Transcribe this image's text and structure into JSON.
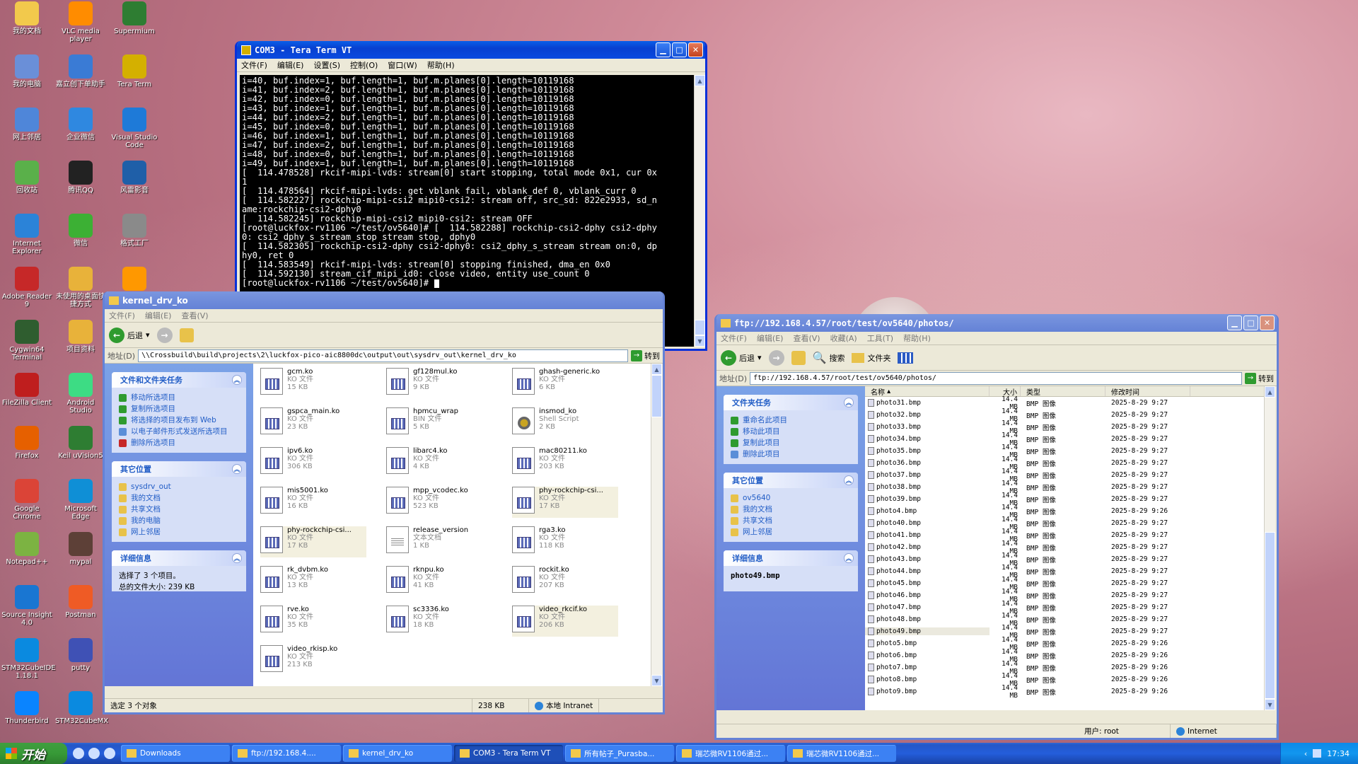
{
  "desktop_icons": [
    {
      "label": "我的文档",
      "color": "#f2c94c"
    },
    {
      "label": "VLC media player",
      "color": "#ff8c00"
    },
    {
      "label": "Supermium",
      "color": "#2e7d32"
    },
    {
      "label": "我的电脑",
      "color": "#6a8fd8"
    },
    {
      "label": "嘉立创下单助手",
      "color": "#3a7bd5"
    },
    {
      "label": "Tera Term",
      "color": "#d4b000"
    },
    {
      "label": "网上邻居",
      "color": "#4f86d9"
    },
    {
      "label": "企业微信",
      "color": "#2f88e0"
    },
    {
      "label": "Visual Studio Code",
      "color": "#1e7ad8"
    },
    {
      "label": "回收站",
      "color": "#5ab04a"
    },
    {
      "label": "腾讯QQ",
      "color": "#222222"
    },
    {
      "label": "风雷影音",
      "color": "#1f5fa8"
    },
    {
      "label": "Internet Explorer",
      "color": "#2b83d8"
    },
    {
      "label": "微信",
      "color": "#3cb034"
    },
    {
      "label": "格式工厂",
      "color": "#8a8a8a"
    },
    {
      "label": "Adobe Reader 9",
      "color": "#c62828"
    },
    {
      "label": "未使用的桌面快捷方式",
      "color": "#e8b23a"
    },
    {
      "label": "",
      "color": "#ff9800"
    },
    {
      "label": "Cygwin64 Terminal",
      "color": "#2f5d2f"
    },
    {
      "label": "项目资料",
      "color": "#e8b23a"
    },
    {
      "label": "FileZilla Client",
      "color": "#bf1e1e"
    },
    {
      "label": "Android Studio",
      "color": "#3ddc84"
    },
    {
      "label": "Firefox",
      "color": "#e66000"
    },
    {
      "label": "Keil uVision5",
      "color": "#2e7d32"
    },
    {
      "label": "Google Chrome",
      "color": "#db4437"
    },
    {
      "label": "Microsoft Edge",
      "color": "#0f8fd6"
    },
    {
      "label": "Notepad++",
      "color": "#7cb342"
    },
    {
      "label": "mypal",
      "color": "#5d4037"
    },
    {
      "label": "Source Insight 4.0",
      "color": "#1976d2"
    },
    {
      "label": "Postman",
      "color": "#ef5b25"
    },
    {
      "label": "STM32CubeIDE 1.18.1",
      "color": "#0a8ae0"
    },
    {
      "label": "putty",
      "color": "#3f51b5"
    },
    {
      "label": "Thunderbird",
      "color": "#0a84ff"
    },
    {
      "label": "STM32CubeMX",
      "color": "#0a8ae0"
    }
  ],
  "tera": {
    "title": "COM3 - Tera Term VT",
    "menu": [
      "文件(F)",
      "编辑(E)",
      "设置(S)",
      "控制(O)",
      "窗口(W)",
      "帮助(H)"
    ],
    "lines": [
      "i=40, buf.index=1, buf.length=1, buf.m.planes[0].length=10119168",
      "i=41, buf.index=2, buf.length=1, buf.m.planes[0].length=10119168",
      "i=42, buf.index=0, buf.length=1, buf.m.planes[0].length=10119168",
      "i=43, buf.index=1, buf.length=1, buf.m.planes[0].length=10119168",
      "i=44, buf.index=2, buf.length=1, buf.m.planes[0].length=10119168",
      "i=45, buf.index=0, buf.length=1, buf.m.planes[0].length=10119168",
      "i=46, buf.index=1, buf.length=1, buf.m.planes[0].length=10119168",
      "i=47, buf.index=2, buf.length=1, buf.m.planes[0].length=10119168",
      "i=48, buf.index=0, buf.length=1, buf.m.planes[0].length=10119168",
      "i=49, buf.index=1, buf.length=1, buf.m.planes[0].length=10119168",
      "[  114.478528] rkcif-mipi-lvds: stream[0] start stopping, total mode 0x1, cur 0x",
      "1",
      "[  114.478564] rkcif-mipi-lvds: get vblank fail, vblank_def 0, vblank_curr 0",
      "[  114.582227] rockchip-mipi-csi2 mipi0-csi2: stream off, src_sd: 822e2933, sd_n",
      "ame:rockchip-csi2-dphy0",
      "[  114.582245] rockchip-mipi-csi2 mipi0-csi2: stream OFF",
      "[root@luckfox-rv1106 ~/test/ov5640]# [  114.582288] rockchip-csi2-dphy csi2-dphy",
      "0: csi2_dphy_s_stream_stop stream stop, dphy0",
      "[  114.582305] rockchip-csi2-dphy csi2-dphy0: csi2_dphy_s_stream stream on:0, dp",
      "hy0, ret 0",
      "[  114.583549] rkcif-mipi-lvds: stream[0] stopping finished, dma_en 0x0",
      "[  114.592130] stream_cif_mipi_id0: close video, entity use_count 0",
      "",
      "[root@luckfox-rv1106 ~/test/ov5640]# "
    ]
  },
  "kernel": {
    "title": "kernel_drv_ko",
    "menu": [
      "文件(F)",
      "编辑(E)",
      "查看(V)"
    ],
    "back": "后退",
    "addr_label": "地址(D)",
    "addr": "\\\\Crossbuild\\build\\projects\\2\\luckfox-pico-aic8800dc\\output\\out\\sysdrv_out\\kernel_drv_ko",
    "go": "转到",
    "tasks_title": "文件和文件夹任务",
    "tasks": [
      "移动所选项目",
      "复制所选项目",
      "将选择的项目发布到 Web",
      "以电子邮件形式发送所选项目",
      "删除所选项目"
    ],
    "places_title": "其它位置",
    "places": [
      "sysdrv_out",
      "我的文档",
      "共享文档",
      "我的电脑",
      "网上邻居"
    ],
    "details_title": "详细信息",
    "details_text": "选择了 3 个项目。",
    "details_text2": "总的文件大小: 239 KB",
    "files": [
      {
        "name": "gcm.ko",
        "type": "KO 文件",
        "size": "15 KB",
        "icon": "ko"
      },
      {
        "name": "gf128mul.ko",
        "type": "KO 文件",
        "size": "9 KB",
        "icon": "ko"
      },
      {
        "name": "ghash-generic.ko",
        "type": "KO 文件",
        "size": "6 KB",
        "icon": "ko"
      },
      {
        "name": "gspca_main.ko",
        "type": "KO 文件",
        "size": "23 KB",
        "icon": "ko"
      },
      {
        "name": "hpmcu_wrap",
        "type": "BIN 文件",
        "size": "5 KB",
        "icon": "ko"
      },
      {
        "name": "insmod_ko",
        "type": "Shell Script",
        "size": "2 KB",
        "icon": "gear"
      },
      {
        "name": "ipv6.ko",
        "type": "KO 文件",
        "size": "306 KB",
        "icon": "ko"
      },
      {
        "name": "libarc4.ko",
        "type": "KO 文件",
        "size": "4 KB",
        "icon": "ko"
      },
      {
        "name": "mac80211.ko",
        "type": "KO 文件",
        "size": "203 KB",
        "icon": "ko"
      },
      {
        "name": "mis5001.ko",
        "type": "KO 文件",
        "size": "16 KB",
        "icon": "ko"
      },
      {
        "name": "mpp_vcodec.ko",
        "type": "KO 文件",
        "size": "523 KB",
        "icon": "ko"
      },
      {
        "name": "phy-rockchip-csi...",
        "type": "KO 文件",
        "size": "17 KB",
        "icon": "ko",
        "sel": true
      },
      {
        "name": "phy-rockchip-csi...",
        "type": "KO 文件",
        "size": "17 KB",
        "icon": "ko",
        "sel": true
      },
      {
        "name": "release_version",
        "type": "文本文档",
        "size": "1 KB",
        "icon": "txt"
      },
      {
        "name": "rga3.ko",
        "type": "KO 文件",
        "size": "118 KB",
        "icon": "ko"
      },
      {
        "name": "rk_dvbm.ko",
        "type": "KO 文件",
        "size": "13 KB",
        "icon": "ko"
      },
      {
        "name": "rknpu.ko",
        "type": "KO 文件",
        "size": "41 KB",
        "icon": "ko"
      },
      {
        "name": "rockit.ko",
        "type": "KO 文件",
        "size": "207 KB",
        "icon": "ko"
      },
      {
        "name": "rve.ko",
        "type": "KO 文件",
        "size": "35 KB",
        "icon": "ko"
      },
      {
        "name": "sc3336.ko",
        "type": "KO 文件",
        "size": "18 KB",
        "icon": "ko"
      },
      {
        "name": "video_rkcif.ko",
        "type": "KO 文件",
        "size": "206 KB",
        "icon": "ko",
        "sel": true
      },
      {
        "name": "video_rkisp.ko",
        "type": "KO 文件",
        "size": "213 KB",
        "icon": "ko"
      }
    ],
    "status": [
      "选定 3 个对象",
      "238 KB",
      "本地 Intranet"
    ]
  },
  "ftp": {
    "title": "ftp://192.168.4.57/root/test/ov5640/photos/",
    "menu": [
      "文件(F)",
      "编辑(E)",
      "查看(V)",
      "收藏(A)",
      "工具(T)",
      "帮助(H)"
    ],
    "back": "后退",
    "search": "搜索",
    "folders": "文件夹",
    "addr_label": "地址(D)",
    "addr": "ftp://192.168.4.57/root/test/ov5640/photos/",
    "go": "转到",
    "tasks_title": "文件夹任务",
    "tasks": [
      "重命名此项目",
      "移动此项目",
      "复制此项目",
      "删除此项目"
    ],
    "places_title": "其它位置",
    "places": [
      "ov5640",
      "我的文档",
      "共享文档",
      "网上邻居"
    ],
    "details_title": "详细信息",
    "details_name": "photo49.bmp",
    "cols": [
      "名称",
      "大小",
      "类型",
      "修改时间"
    ],
    "rows": [
      [
        "photo31.bmp",
        "14.4 MB",
        "BMP 图像",
        "2025-8-29 9:27"
      ],
      [
        "photo32.bmp",
        "14.4 MB",
        "BMP 图像",
        "2025-8-29 9:27"
      ],
      [
        "photo33.bmp",
        "14.4 MB",
        "BMP 图像",
        "2025-8-29 9:27"
      ],
      [
        "photo34.bmp",
        "14.4 MB",
        "BMP 图像",
        "2025-8-29 9:27"
      ],
      [
        "photo35.bmp",
        "14.4 MB",
        "BMP 图像",
        "2025-8-29 9:27"
      ],
      [
        "photo36.bmp",
        "14.4 MB",
        "BMP 图像",
        "2025-8-29 9:27"
      ],
      [
        "photo37.bmp",
        "14.4 MB",
        "BMP 图像",
        "2025-8-29 9:27"
      ],
      [
        "photo38.bmp",
        "14.4 MB",
        "BMP 图像",
        "2025-8-29 9:27"
      ],
      [
        "photo39.bmp",
        "14.4 MB",
        "BMP 图像",
        "2025-8-29 9:27"
      ],
      [
        "photo4.bmp",
        "14.4 MB",
        "BMP 图像",
        "2025-8-29 9:26"
      ],
      [
        "photo40.bmp",
        "14.4 MB",
        "BMP 图像",
        "2025-8-29 9:27"
      ],
      [
        "photo41.bmp",
        "14.4 MB",
        "BMP 图像",
        "2025-8-29 9:27"
      ],
      [
        "photo42.bmp",
        "14.4 MB",
        "BMP 图像",
        "2025-8-29 9:27"
      ],
      [
        "photo43.bmp",
        "14.4 MB",
        "BMP 图像",
        "2025-8-29 9:27"
      ],
      [
        "photo44.bmp",
        "14.4 MB",
        "BMP 图像",
        "2025-8-29 9:27"
      ],
      [
        "photo45.bmp",
        "14.4 MB",
        "BMP 图像",
        "2025-8-29 9:27"
      ],
      [
        "photo46.bmp",
        "14.4 MB",
        "BMP 图像",
        "2025-8-29 9:27"
      ],
      [
        "photo47.bmp",
        "14.4 MB",
        "BMP 图像",
        "2025-8-29 9:27"
      ],
      [
        "photo48.bmp",
        "14.4 MB",
        "BMP 图像",
        "2025-8-29 9:27"
      ],
      [
        "photo49.bmp",
        "14.4 MB",
        "BMP 图像",
        "2025-8-29 9:27"
      ],
      [
        "photo5.bmp",
        "14.4 MB",
        "BMP 图像",
        "2025-8-29 9:26"
      ],
      [
        "photo6.bmp",
        "14.4 MB",
        "BMP 图像",
        "2025-8-29 9:26"
      ],
      [
        "photo7.bmp",
        "14.4 MB",
        "BMP 图像",
        "2025-8-29 9:26"
      ],
      [
        "photo8.bmp",
        "14.4 MB",
        "BMP 图像",
        "2025-8-29 9:26"
      ],
      [
        "photo9.bmp",
        "14.4 MB",
        "BMP 图像",
        "2025-8-29 9:26"
      ]
    ],
    "selected_row": 19,
    "status": [
      "用户: root",
      "Internet"
    ]
  },
  "taskbar": {
    "start": "开始",
    "tasks": [
      "Downloads",
      "ftp://192.168.4....",
      "kernel_drv_ko",
      "COM3 - Tera Term VT",
      "所有帖子_Purasba...",
      "瑞芯微RV1106通过...",
      "瑞芯微RV1106通过..."
    ],
    "active": 3,
    "clock": "17:34"
  }
}
